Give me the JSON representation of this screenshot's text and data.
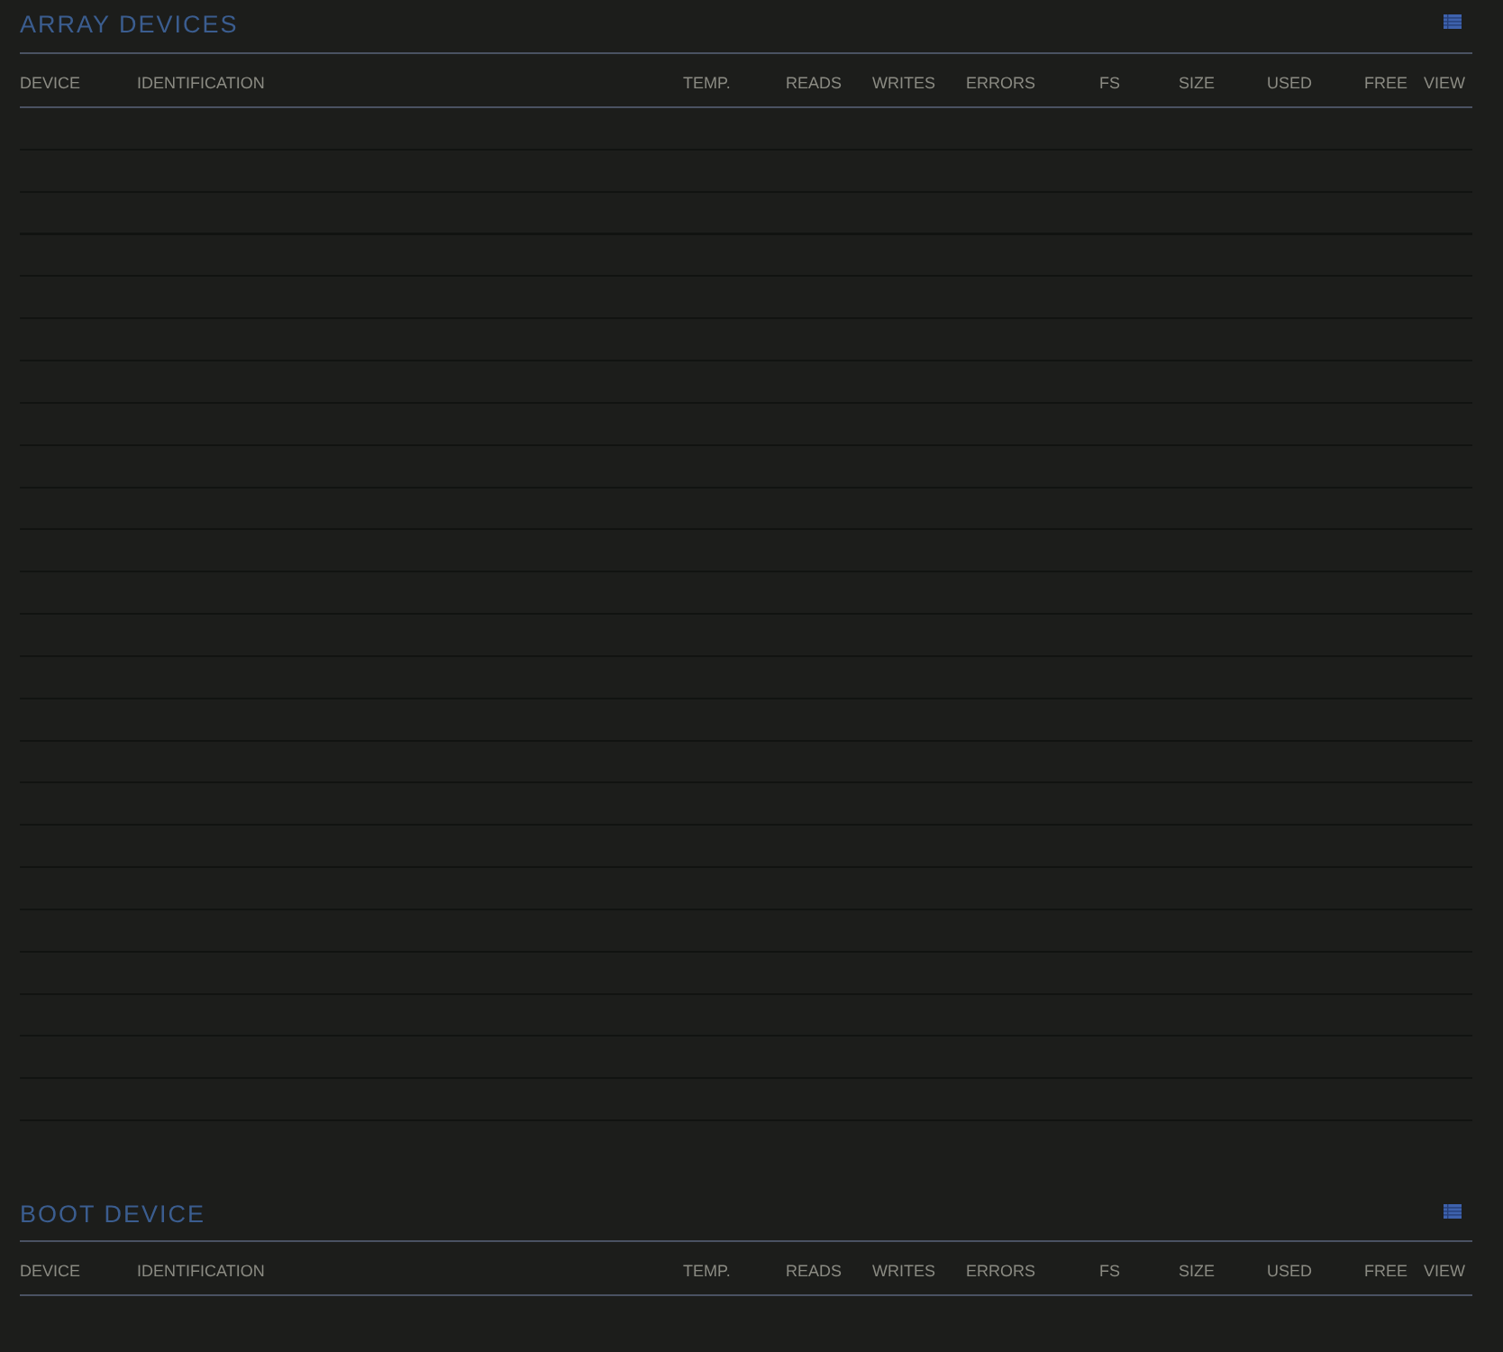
{
  "sections": [
    {
      "title": "ARRAY DEVICES",
      "columns": [
        "DEVICE",
        "IDENTIFICATION",
        "TEMP.",
        "READS",
        "WRITES",
        "ERRORS",
        "FS",
        "SIZE",
        "USED",
        "FREE",
        "VIEW"
      ]
    },
    {
      "title": "BOOT DEVICE",
      "columns": [
        "DEVICE",
        "IDENTIFICATION",
        "TEMP.",
        "READS",
        "WRITES",
        "ERRORS",
        "FS",
        "SIZE",
        "USED",
        "FREE",
        "VIEW"
      ]
    }
  ]
}
